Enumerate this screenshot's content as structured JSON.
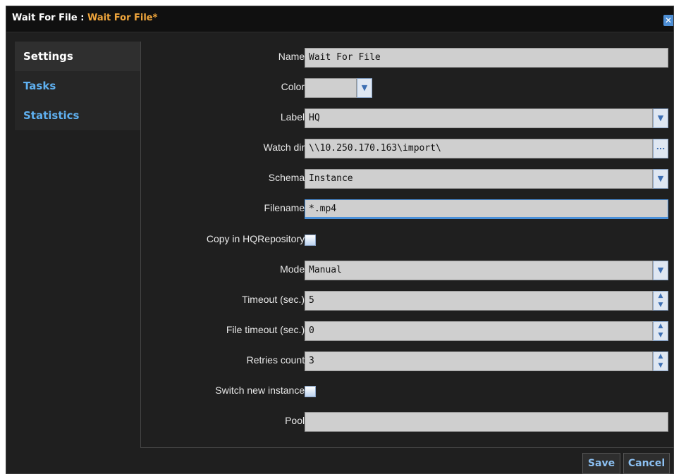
{
  "window": {
    "title_prefix": "Wait For File : ",
    "title_highlight": "Wait For File*"
  },
  "icons": {
    "close": "close-icon",
    "dropdown": "chevron-down-icon",
    "browse": "ellipsis-icon",
    "spinner": "spinner-arrows-icon"
  },
  "sidebar": {
    "items": [
      {
        "label": "Settings"
      },
      {
        "label": "Tasks"
      },
      {
        "label": "Statistics"
      }
    ]
  },
  "form": {
    "name": {
      "label": "Name:",
      "value": "Wait For File"
    },
    "color": {
      "label": "Color:"
    },
    "label_field": {
      "label": "Label:",
      "value": "HQ"
    },
    "watch_dir": {
      "label": "Watch dir:",
      "value": "\\\\10.250.170.163\\import\\",
      "browse": "..."
    },
    "schema": {
      "label": "Schema:",
      "value": "Instance"
    },
    "filename": {
      "label": "Filename:",
      "value": "*.mp4"
    },
    "copy_repo": {
      "label": "Copy in HQRepository:"
    },
    "mode": {
      "label": "Mode:",
      "value": "Manual"
    },
    "timeout": {
      "label": "Timeout (sec.):",
      "value": "5"
    },
    "file_timeout": {
      "label": "File timeout (sec.):",
      "value": "0"
    },
    "retries": {
      "label": "Retries count:",
      "value": "3"
    },
    "switch_instance": {
      "label": "Switch new instance:"
    },
    "pool": {
      "label": "Pool:",
      "value": ""
    }
  },
  "buttons": {
    "save": "Save",
    "cancel": "Cancel"
  },
  "colors": {
    "accent": "#f0a63c",
    "link": "#5fb0f0",
    "background": "#1f1f1f"
  }
}
